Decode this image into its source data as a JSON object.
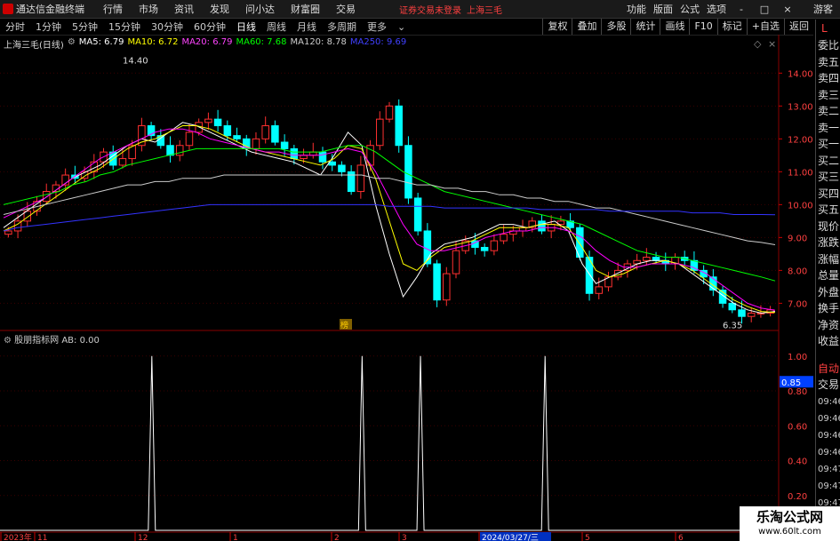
{
  "app": {
    "title": "通达信金融终端",
    "menu": [
      "行情",
      "市场",
      "资讯",
      "发现",
      "问小达",
      "财富圈",
      "交易"
    ],
    "login_msg": "证券交易未登录",
    "stock_tag": "上海三毛",
    "right_menu": [
      "功能",
      "版面",
      "公式",
      "选项"
    ],
    "guest": "游客",
    "window_controls": [
      "-",
      "□",
      "×"
    ]
  },
  "timeframes": {
    "items": [
      "分时",
      "1分钟",
      "5分钟",
      "15分钟",
      "30分钟",
      "60分钟",
      "日线",
      "周线",
      "月线",
      "多周期",
      "更多"
    ],
    "active": "日线"
  },
  "tools": [
    "复权",
    "叠加",
    "多股",
    "统计",
    "画线",
    "F10",
    "标记",
    "+自选",
    "返回"
  ],
  "legend": {
    "stock": "上海三毛(日线)",
    "ma5": "MA5: 6.79",
    "ma10": "MA10: 6.72",
    "ma20": "MA20: 6.79",
    "ma60": "MA60: 7.68",
    "ma120": "MA120: 8.78",
    "ma250": "MA250: 9.69",
    "colors": {
      "ma5": "#ffffff",
      "ma10": "#ffff00",
      "ma20": "#ff00ff",
      "ma60": "#00ff00",
      "ma120": "#cccccc",
      "ma250": "#3333ff"
    }
  },
  "indicator": {
    "label": "股朋指标网 AB: 0.00"
  },
  "right_panel": {
    "corner": "L",
    "items": [
      "委比",
      "卖五",
      "卖四",
      "卖三",
      "卖二",
      "卖一",
      "买一",
      "买二",
      "买三",
      "买四",
      "买五",
      "现价",
      "涨跌",
      "涨幅",
      "总量",
      "外盘",
      "换手",
      "净资",
      "收益"
    ],
    "lower_items": [
      "自动",
      "交易"
    ],
    "times": [
      "09:46",
      "09:46",
      "09:46",
      "09:46",
      "09:47",
      "09:47",
      "09:47",
      "09:47"
    ]
  },
  "chart_data": [
    {
      "type": "candlestick",
      "title": "",
      "y_ticks": [
        "14.00",
        "13.00",
        "12.00",
        "11.00",
        "10.00",
        "9.00",
        "8.00",
        "7.00"
      ],
      "ylim": [
        6.2,
        14.9
      ],
      "annotations": [
        {
          "label": "14.40",
          "value": 14.4
        },
        {
          "label": "6.35",
          "value": 6.35
        }
      ],
      "badge": "榜",
      "x_ticks": [
        "2023年",
        "11",
        "12",
        "1",
        "2",
        "3",
        "2024/03/27/三",
        "5",
        "6"
      ],
      "close_series": [
        9.2,
        9.5,
        9.8,
        10.1,
        10.4,
        10.6,
        10.9,
        10.8,
        11.0,
        11.3,
        11.6,
        11.2,
        11.4,
        11.8,
        12.4,
        12.1,
        11.8,
        11.5,
        11.8,
        12.2,
        12.5,
        12.6,
        12.4,
        12.1,
        12.0,
        11.7,
        12.0,
        12.4,
        11.9,
        11.7,
        11.4,
        11.5,
        11.6,
        11.3,
        11.2,
        11.0,
        10.4,
        11.2,
        11.8,
        12.6,
        13.0,
        11.8,
        10.2,
        9.2,
        8.2,
        7.1,
        7.9,
        8.6,
        8.9,
        8.7,
        8.6,
        8.9,
        9.1,
        9.2,
        9.3,
        9.5,
        9.2,
        9.4,
        9.5,
        9.3,
        8.4,
        7.3,
        7.5,
        7.8,
        8.0,
        8.2,
        8.3,
        8.4,
        8.3,
        8.2,
        8.4,
        8.3,
        8.0,
        7.8,
        7.4,
        7.0,
        6.8,
        6.6,
        6.7,
        6.7,
        6.8
      ],
      "ma": {
        "ma5": [
          9.3,
          9.6,
          9.9,
          10.2,
          10.5,
          10.8,
          11.0,
          11.2,
          11.5,
          11.8,
          12.0,
          11.9,
          12.2,
          12.5,
          12.4,
          12.2,
          12.0,
          11.8,
          11.6,
          11.5,
          11.4,
          11.3,
          11.1,
          10.9,
          11.5,
          12.2,
          11.8,
          10.0,
          8.5,
          7.2,
          7.8,
          8.5,
          8.8,
          8.9,
          9.0,
          9.2,
          9.4,
          9.4,
          9.3,
          9.4,
          9.5,
          9.2,
          8.2,
          7.6,
          7.8,
          8.0,
          8.2,
          8.3,
          8.3,
          8.2,
          7.9,
          7.6,
          7.3,
          7.0,
          6.8,
          6.7,
          6.75
        ],
        "ma10": [
          9.2,
          9.4,
          9.7,
          10.0,
          10.3,
          10.6,
          10.9,
          11.1,
          11.4,
          11.7,
          11.9,
          12.0,
          12.2,
          12.4,
          12.4,
          12.3,
          12.1,
          11.9,
          11.7,
          11.6,
          11.5,
          11.4,
          11.3,
          11.2,
          11.4,
          11.8,
          11.7,
          10.8,
          9.5,
          8.2,
          8.0,
          8.4,
          8.7,
          8.8,
          8.9,
          9.1,
          9.3,
          9.3,
          9.3,
          9.4,
          9.4,
          9.3,
          8.7,
          8.0,
          7.8,
          7.9,
          8.1,
          8.2,
          8.3,
          8.2,
          8.0,
          7.7,
          7.4,
          7.1,
          6.9,
          6.75,
          6.72
        ],
        "ma20": [
          9.6,
          9.8,
          10.0,
          10.2,
          10.5,
          10.8,
          11.1,
          11.4,
          11.6,
          11.8,
          12.0,
          12.2,
          12.3,
          12.3,
          12.2,
          12.0,
          11.9,
          11.8,
          11.7,
          11.6,
          11.6,
          11.5,
          11.5,
          11.5,
          11.6,
          11.7,
          11.6,
          11.0,
          10.2,
          9.4,
          8.8,
          8.6,
          8.6,
          8.7,
          8.8,
          9.0,
          9.1,
          9.2,
          9.2,
          9.3,
          9.3,
          9.2,
          9.0,
          8.6,
          8.3,
          8.1,
          8.1,
          8.2,
          8.2,
          8.2,
          8.1,
          7.9,
          7.6,
          7.3,
          7.0,
          6.85,
          6.79
        ],
        "ma60": [
          10.0,
          10.1,
          10.2,
          10.3,
          10.4,
          10.6,
          10.7,
          10.9,
          11.0,
          11.2,
          11.3,
          11.4,
          11.5,
          11.6,
          11.7,
          11.7,
          11.7,
          11.7,
          11.7,
          11.7,
          11.7,
          11.6,
          11.6,
          11.6,
          11.7,
          11.8,
          11.8,
          11.6,
          11.3,
          11.0,
          10.8,
          10.6,
          10.4,
          10.3,
          10.2,
          10.1,
          10.0,
          9.9,
          9.8,
          9.7,
          9.6,
          9.5,
          9.4,
          9.2,
          9.0,
          8.8,
          8.6,
          8.5,
          8.4,
          8.4,
          8.3,
          8.2,
          8.1,
          8.0,
          7.9,
          7.8,
          7.68
        ],
        "ma120": [
          9.7,
          9.8,
          9.9,
          10.0,
          10.1,
          10.2,
          10.3,
          10.4,
          10.5,
          10.6,
          10.6,
          10.7,
          10.7,
          10.8,
          10.8,
          10.8,
          10.9,
          10.9,
          10.9,
          10.9,
          10.9,
          10.9,
          10.9,
          10.9,
          10.9,
          10.9,
          10.9,
          10.8,
          10.8,
          10.7,
          10.6,
          10.6,
          10.5,
          10.5,
          10.4,
          10.4,
          10.3,
          10.3,
          10.2,
          10.2,
          10.1,
          10.1,
          10.0,
          9.9,
          9.9,
          9.8,
          9.7,
          9.6,
          9.5,
          9.4,
          9.3,
          9.2,
          9.1,
          9.0,
          8.9,
          8.85,
          8.78
        ],
        "ma250": [
          9.2,
          9.3,
          9.35,
          9.4,
          9.45,
          9.5,
          9.55,
          9.6,
          9.65,
          9.7,
          9.75,
          9.8,
          9.85,
          9.9,
          9.95,
          10.0,
          10.0,
          10.0,
          10.0,
          10.0,
          10.0,
          10.0,
          10.0,
          10.0,
          10.0,
          10.0,
          10.0,
          10.0,
          9.95,
          9.95,
          9.95,
          9.95,
          9.9,
          9.9,
          9.9,
          9.9,
          9.9,
          9.9,
          9.9,
          9.85,
          9.85,
          9.85,
          9.85,
          9.85,
          9.8,
          9.8,
          9.8,
          9.8,
          9.8,
          9.8,
          9.75,
          9.75,
          9.75,
          9.7,
          9.7,
          9.7,
          9.69
        ]
      }
    },
    {
      "type": "line",
      "title": "",
      "y_ticks": [
        "1.00",
        "0.80",
        "0.60",
        "0.40",
        "0.20"
      ],
      "current_value_label": "0.85",
      "ylim": [
        0,
        1.05
      ],
      "spikes_x": [
        0.195,
        0.465,
        0.54,
        0.7
      ],
      "spike_value": 1.0
    }
  ]
}
